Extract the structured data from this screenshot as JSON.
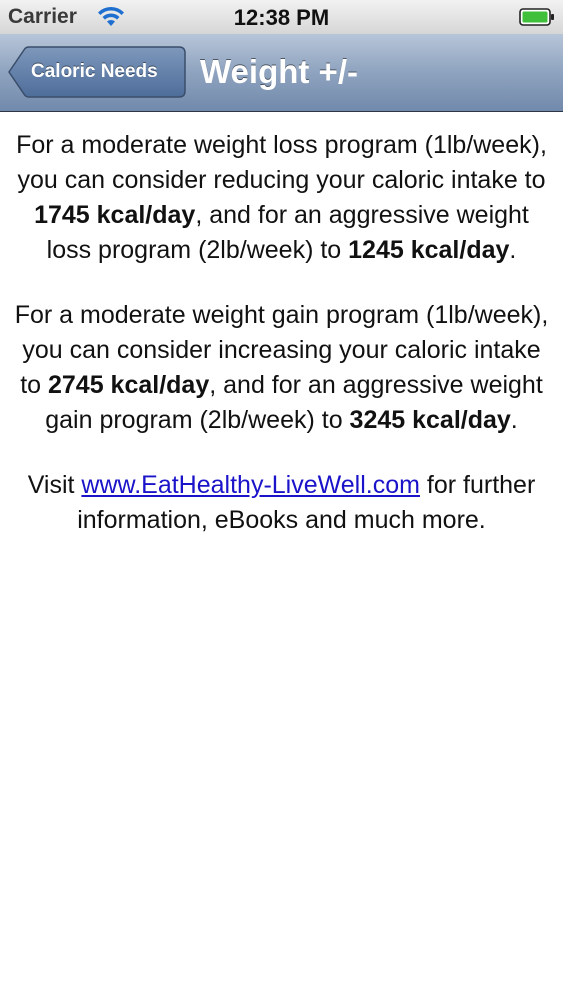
{
  "status_bar": {
    "carrier": "Carrier",
    "time": "12:38 PM",
    "icons": [
      "wifi-icon",
      "battery-icon"
    ]
  },
  "nav_bar": {
    "back_label": "Caloric Needs",
    "title": "Weight +/-",
    "colors": {
      "bar_top": "#b7c5d8",
      "bar_bottom": "#7189ab",
      "back_button": "#5d7aa3"
    }
  },
  "content": {
    "loss": {
      "text_1": "For a moderate weight loss program (1lb/week), you can consider reducing your caloric intake to ",
      "value_1": "1745 kcal/day",
      "text_2": ", and for an aggressive weight loss program (2lb/week) to ",
      "value_2": "1245 kcal/day",
      "text_3": "."
    },
    "gain": {
      "text_1": "For a moderate weight gain program (1lb/week), you can consider increasing your caloric intake to ",
      "value_1": "2745 kcal/day",
      "text_2": ", and for an aggressive weight gain program (2lb/week) to ",
      "value_2": "3245 kcal/day",
      "text_3": "."
    },
    "visit": {
      "prefix": "Visit ",
      "link": "www.EatHealthy-LiveWell.com",
      "suffix": " for further information, eBooks and much more."
    },
    "link_color": "#1a13c9"
  }
}
